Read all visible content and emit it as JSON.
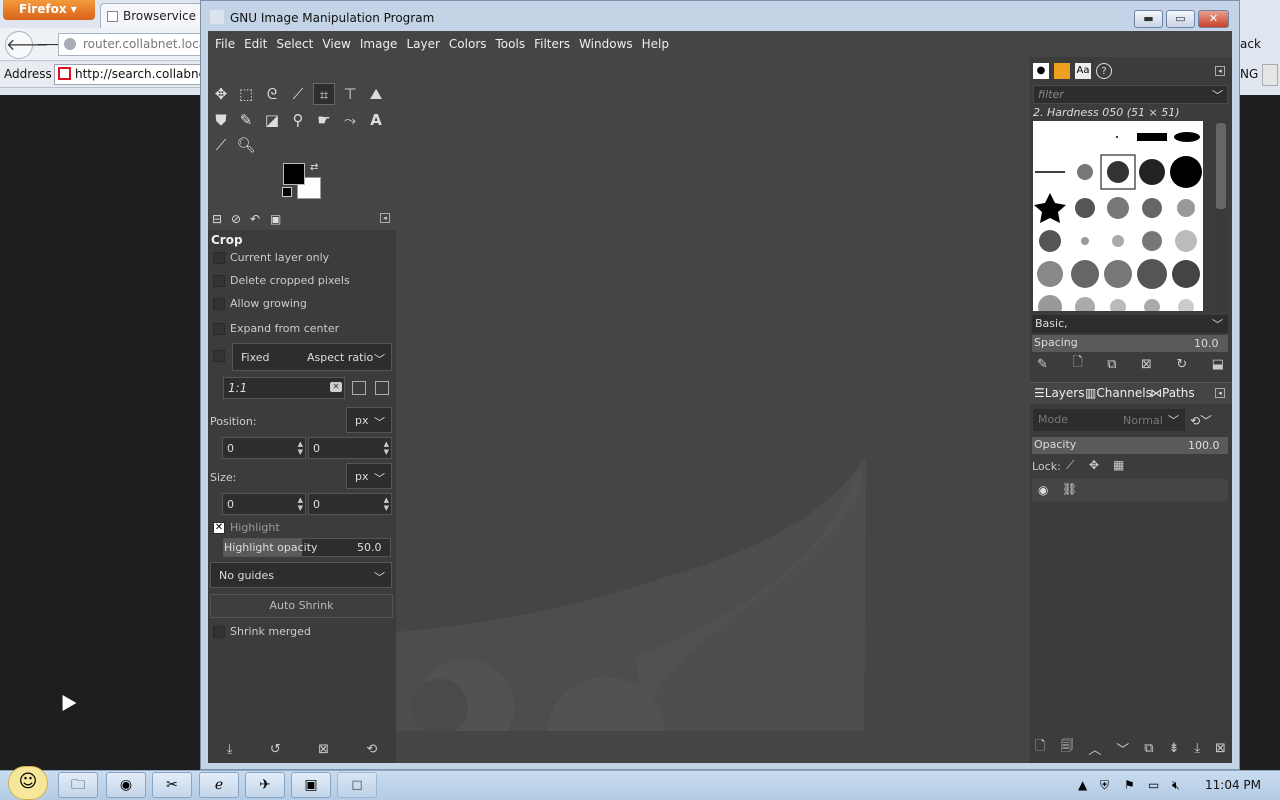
{
  "firefox": {
    "menu_button": "Firefox",
    "tab_title": "Browservice",
    "url": "router.collabnet.local:",
    "address_label": "Address",
    "address_value": "http://search.collabnet",
    "right_text_1": "ack",
    "right_text_2": "NG"
  },
  "gimp": {
    "window_title": "GNU Image Manipulation Program",
    "menu": [
      "File",
      "Edit",
      "Select",
      "View",
      "Image",
      "Layer",
      "Colors",
      "Tools",
      "Filters",
      "Windows",
      "Help"
    ],
    "tool_options": {
      "title": "Crop",
      "current_layer_only": "Current layer only",
      "delete_cropped": "Delete cropped pixels",
      "allow_growing": "Allow growing",
      "expand_center": "Expand from center",
      "fixed": "Fixed",
      "fixed_mode": "Aspect ratio",
      "ratio": "1:1",
      "position_label": "Position:",
      "position_unit": "px",
      "position_x": "0",
      "position_y": "0",
      "size_label": "Size:",
      "size_unit": "px",
      "size_w": "0",
      "size_h": "0",
      "highlight": "Highlight",
      "highlight_opacity_label": "Highlight opacity",
      "highlight_opacity_value": "50.0",
      "guides": "No guides",
      "auto_shrink": "Auto Shrink",
      "shrink_merged": "Shrink merged"
    },
    "brushes": {
      "filter_placeholder": "filter",
      "selected": "2. Hardness 050 (51 × 51)",
      "preset": "Basic,",
      "spacing_label": "Spacing",
      "spacing_value": "10.0"
    },
    "layers": {
      "tabs": [
        "Layers",
        "Channels",
        "Paths"
      ],
      "mode_label": "Mode",
      "mode_value": "Normal",
      "opacity_label": "Opacity",
      "opacity_value": "100.0",
      "lock_label": "Lock:"
    }
  },
  "taskbar": {
    "clock": "11:04 PM"
  }
}
